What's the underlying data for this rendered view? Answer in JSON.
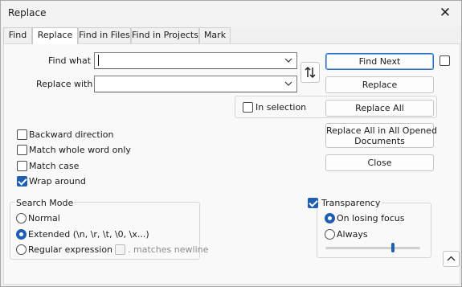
{
  "window": {
    "title": "Replace"
  },
  "tabs": [
    {
      "label": "Find"
    },
    {
      "label": "Replace"
    },
    {
      "label": "Find in Files"
    },
    {
      "label": "Find in Projects"
    },
    {
      "label": "Mark"
    }
  ],
  "active_tab": "Replace",
  "find": {
    "label": "Find what :",
    "value": ""
  },
  "replace": {
    "label": "Replace with :",
    "value": ""
  },
  "in_selection": {
    "label": "In selection",
    "checked": false
  },
  "buttons": {
    "find_next": "Find Next",
    "replace": "Replace",
    "replace_all": "Replace All",
    "replace_all_opened_line1": "Replace All in All Opened",
    "replace_all_opened_line2": "Documents",
    "close": "Close"
  },
  "options": [
    {
      "label": "Backward direction",
      "checked": false
    },
    {
      "label": "Match whole word only",
      "checked": false
    },
    {
      "label": "Match case",
      "checked": false
    },
    {
      "label": "Wrap around",
      "checked": true
    }
  ],
  "search_mode": {
    "title": "Search Mode",
    "modes": [
      {
        "label": "Normal",
        "checked": false
      },
      {
        "label": "Extended (\\n, \\r, \\t, \\0, \\x...)",
        "checked": true
      },
      {
        "label": "Regular expression",
        "checked": false
      }
    ],
    "matches_newline": {
      "label": ". matches newline",
      "checked": false,
      "enabled": false
    }
  },
  "transparency": {
    "label": "Transparency",
    "checked": true,
    "modes": [
      {
        "label": "On losing focus",
        "checked": true
      },
      {
        "label": "Always",
        "checked": false
      }
    ],
    "slider_level": 0.71
  },
  "colors": {
    "accent": "#1e5fb3"
  }
}
